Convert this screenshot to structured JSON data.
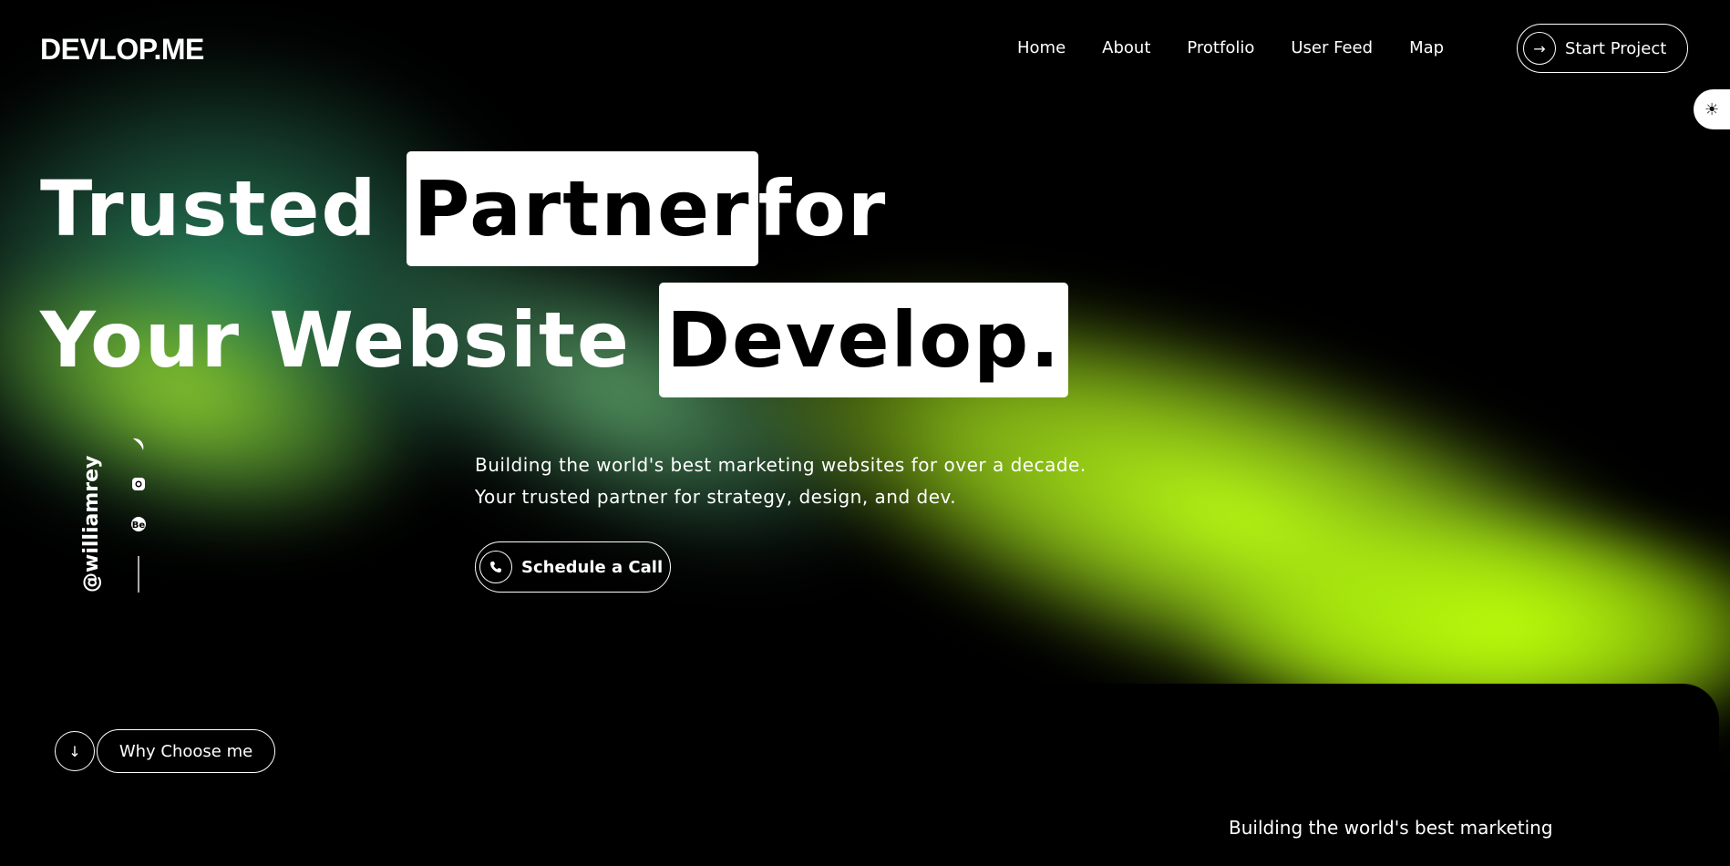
{
  "brand": {
    "logo": "DEVLOP.ME"
  },
  "nav": {
    "items": [
      "Home",
      "About",
      "Protfolio",
      "User Feed",
      "Map"
    ]
  },
  "header": {
    "start_label": "Start Project",
    "start_icon": "arrow-right-icon"
  },
  "theme_toggle": {
    "icon": "sun-icon"
  },
  "hero": {
    "line1_part1": "Trusted ",
    "line1_highlight": "Partner",
    "line1_part2": "for",
    "line2_part1": "Your Website ",
    "line2_highlight": "Develop."
  },
  "social": {
    "handle": "@williamrey",
    "icons": [
      "dribbble-icon",
      "instagram-icon",
      "behance-icon"
    ]
  },
  "intro": {
    "line1": "Building the world's best marketing websites for over a decade.",
    "line2": "Your trusted partner for strategy, design, and dev.",
    "cta_label": "Schedule a Call",
    "cta_icon": "phone-icon"
  },
  "why": {
    "label": "Why Choose me",
    "icon": "arrow-down-icon"
  },
  "lower": {
    "text": "Building the world's best marketing"
  },
  "colors": {
    "accent_green": "#b8ff14",
    "teal": "#2a8c64",
    "background": "#000000",
    "highlight": "#ffffff"
  }
}
